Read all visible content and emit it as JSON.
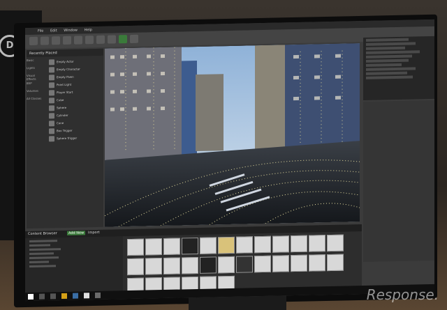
{
  "background_monitor": {
    "logo_text": "D"
  },
  "menubar": {
    "items": [
      "File",
      "Edit",
      "Window",
      "Help"
    ]
  },
  "place_panel": {
    "header": "Recently Placed",
    "categories": [
      "Basic",
      "Lights",
      "Visual Effects",
      "BSP",
      "Volumes",
      "All Classes"
    ],
    "items": [
      "Empty Actor",
      "Empty Character",
      "Empty Pawn",
      "Point Light",
      "Player Start",
      "Cube",
      "Sphere",
      "Cylinder",
      "Cone",
      "Box Trigger",
      "Sphere Trigger"
    ]
  },
  "content_browser": {
    "tab_label": "Content Browser",
    "add_new": "Add New",
    "import": "Import"
  },
  "watermark": "Response."
}
